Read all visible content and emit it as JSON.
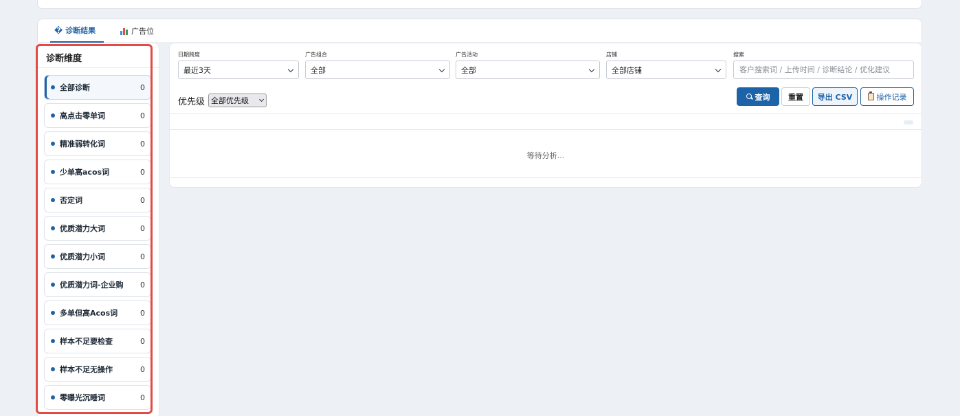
{
  "tabs": [
    {
      "label": "� 诊断结果",
      "active": true
    },
    {
      "label": "广告位",
      "icon": "bar-chart-icon",
      "active": false
    }
  ],
  "sidebar": {
    "title": "诊断维度",
    "items": [
      {
        "label": "全部诊断",
        "count": "0",
        "active": true
      },
      {
        "label": "高点击零单词",
        "count": "0"
      },
      {
        "label": "精准弱转化词",
        "count": "0"
      },
      {
        "label": "少单高acos词",
        "count": "0"
      },
      {
        "label": "否定词",
        "count": "0"
      },
      {
        "label": "优质潜力大词",
        "count": "0"
      },
      {
        "label": "优质潜力小词",
        "count": "0"
      },
      {
        "label": "优质潜力词-企业购",
        "count": "0"
      },
      {
        "label": "多单但高Acos词",
        "count": "0"
      },
      {
        "label": "样本不足要检查",
        "count": "0"
      },
      {
        "label": "样本不足无操作",
        "count": "0"
      },
      {
        "label": "零曝光沉睡词",
        "count": "0"
      }
    ]
  },
  "filters": {
    "date": {
      "label": "日期跨度",
      "value": "最近3天"
    },
    "portfolio": {
      "label": "广告组合",
      "value": "全部"
    },
    "campaign": {
      "label": "广告活动",
      "value": "全部"
    },
    "store": {
      "label": "店铺",
      "value": "全部店铺"
    },
    "search": {
      "label": "搜索",
      "placeholder": "客户搜索词 / 上传时间 / 诊断结论 / 优化建议"
    }
  },
  "priority": {
    "label": "优先级",
    "value": "全部优先级"
  },
  "buttons": {
    "query": "查询",
    "reset": "重置",
    "export": "导出 CSV",
    "log": "操作记录"
  },
  "results": {
    "empty_text": "等待分析..."
  },
  "colors": {
    "accent": "#1d63a8",
    "highlight": "#e24b43"
  }
}
